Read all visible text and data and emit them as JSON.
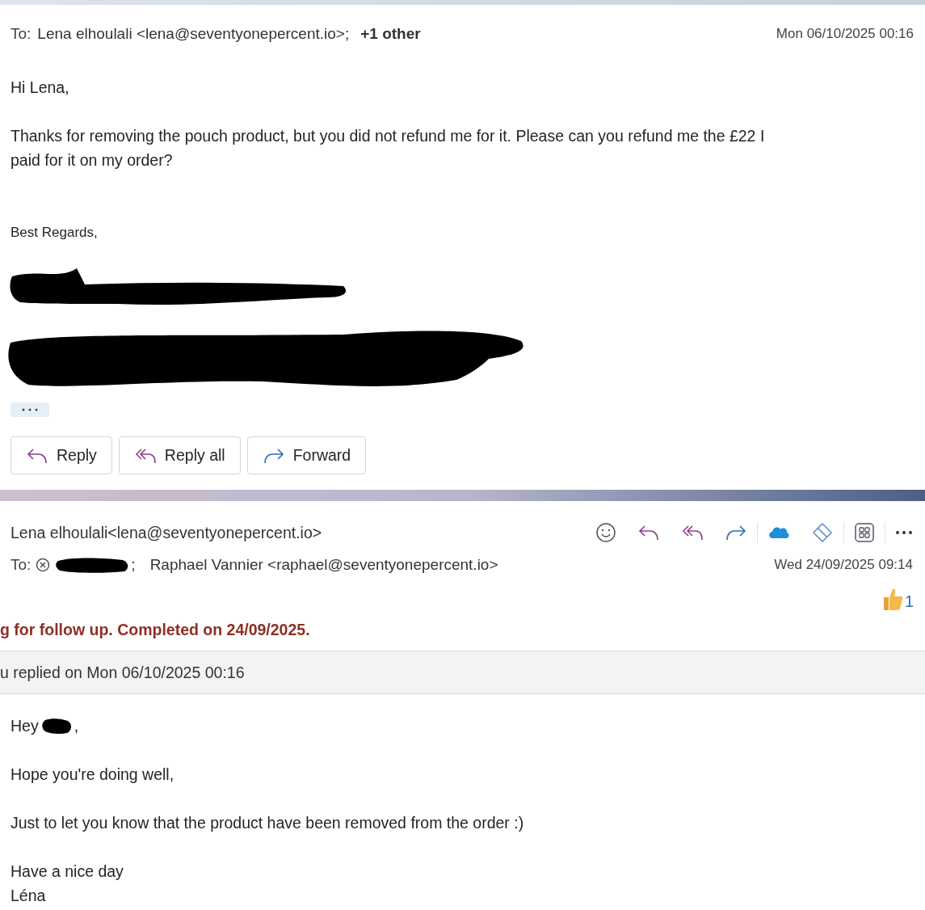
{
  "message_1": {
    "to_label": "To:",
    "recipient": "Lena elhoulali <lena@seventyonepercent.io>;",
    "more_recipients": "+1 other",
    "date": "Mon 06/10/2025 00:16",
    "body": [
      "Hi Lena,",
      "Thanks for removing the pouch product, but you did not refund me for it. Please can you refund me the £22 I paid for it on my order?"
    ],
    "signature": "Best Regards,",
    "actions": [
      {
        "label": "Reply",
        "kind": "reply"
      },
      {
        "label": "Reply all",
        "kind": "reply_all"
      },
      {
        "label": "Forward",
        "kind": "forward"
      }
    ]
  },
  "message_2": {
    "sender": "Lena elhoulali<lena@seventyonepercent.io>",
    "to_label": "To:",
    "recipient_separator": ";",
    "recipient": "Raphael Vannier <raphael@seventyonepercent.io>",
    "date": "Wed 24/09/2025 09:14",
    "reaction_count": "1",
    "follow_up": "g for follow up. Completed on 24/09/2025.",
    "replied_notice": "u replied on Mon 06/10/2025 00:16",
    "greeting": "Hey",
    "greeting_end": ",",
    "body": [
      "Hope you're doing well,",
      "Just to let you know that the product have been removed from the order :)"
    ],
    "closing": [
      "Have a nice day",
      "Léna"
    ]
  }
}
